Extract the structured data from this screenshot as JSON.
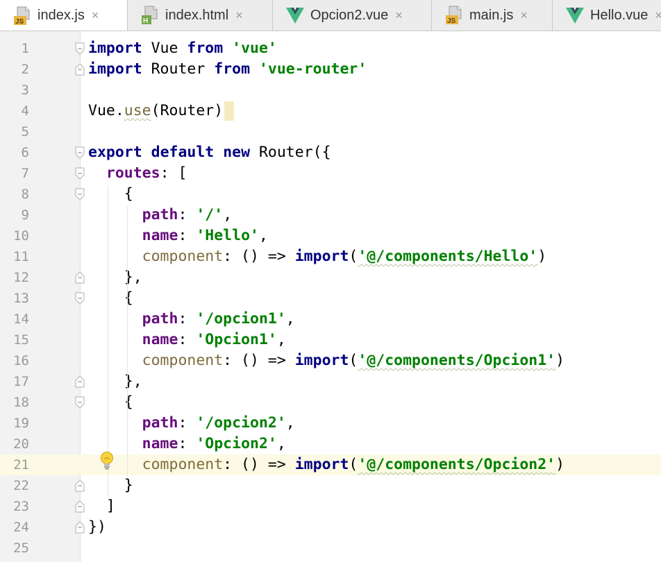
{
  "tabs": [
    {
      "label": "index.js",
      "icon": "js-file-icon",
      "active": true
    },
    {
      "label": "index.html",
      "icon": "html-file-icon",
      "active": false
    },
    {
      "label": "Opcion2.vue",
      "icon": "vue-file-icon",
      "active": false
    },
    {
      "label": "main.js",
      "icon": "js-file-icon",
      "active": false
    },
    {
      "label": "Hello.vue",
      "icon": "vue-file-icon",
      "active": false
    }
  ],
  "tab_close_symbol": "×",
  "colors": {
    "keyword": "#000080",
    "string": "#008000",
    "property": "#660e7a",
    "component_key": "#7d6b3a",
    "line_number": "#999999",
    "current_line": "#fcfae4",
    "vue_green": "#41b883",
    "vue_dark": "#35495e"
  },
  "current_line": 21,
  "lines": [
    {
      "n": "1",
      "t": [
        [
          "kw",
          "import"
        ],
        [
          "p",
          " Vue "
        ],
        [
          "kw",
          "from"
        ],
        [
          "p",
          " "
        ],
        [
          "str",
          "'vue'"
        ]
      ]
    },
    {
      "n": "2",
      "t": [
        [
          "kw",
          "import"
        ],
        [
          "p",
          " Router "
        ],
        [
          "kw",
          "from"
        ],
        [
          "p",
          " "
        ],
        [
          "str",
          "'vue-router'"
        ]
      ]
    },
    {
      "n": "3",
      "t": []
    },
    {
      "n": "4",
      "t": [
        [
          "p",
          "Vue."
        ],
        [
          "fnw",
          "use"
        ],
        [
          "p",
          "(Router)"
        ],
        [
          "caret",
          ""
        ]
      ]
    },
    {
      "n": "5",
      "t": []
    },
    {
      "n": "6",
      "t": [
        [
          "kw",
          "export"
        ],
        [
          "p",
          " "
        ],
        [
          "kw",
          "default"
        ],
        [
          "p",
          " "
        ],
        [
          "kw",
          "new"
        ],
        [
          "p",
          " Router({"
        ]
      ]
    },
    {
      "n": "7",
      "t": [
        [
          "p",
          "  "
        ],
        [
          "prop",
          "routes"
        ],
        [
          "p",
          ": ["
        ]
      ]
    },
    {
      "n": "8",
      "t": [
        [
          "p",
          "    {"
        ]
      ]
    },
    {
      "n": "9",
      "t": [
        [
          "p",
          "      "
        ],
        [
          "prop",
          "path"
        ],
        [
          "p",
          ": "
        ],
        [
          "str",
          "'/'"
        ],
        [
          "p",
          ","
        ]
      ]
    },
    {
      "n": "10",
      "t": [
        [
          "p",
          "      "
        ],
        [
          "prop",
          "name"
        ],
        [
          "p",
          ": "
        ],
        [
          "str",
          "'Hello'"
        ],
        [
          "p",
          ","
        ]
      ]
    },
    {
      "n": "11",
      "t": [
        [
          "p",
          "      "
        ],
        [
          "comp",
          "component"
        ],
        [
          "p",
          ": () => "
        ],
        [
          "kw",
          "import"
        ],
        [
          "p",
          "("
        ],
        [
          "strw",
          "'@/components/Hello'"
        ],
        [
          "p",
          ")"
        ]
      ]
    },
    {
      "n": "12",
      "t": [
        [
          "p",
          "    },"
        ]
      ]
    },
    {
      "n": "13",
      "t": [
        [
          "p",
          "    {"
        ]
      ]
    },
    {
      "n": "14",
      "t": [
        [
          "p",
          "      "
        ],
        [
          "prop",
          "path"
        ],
        [
          "p",
          ": "
        ],
        [
          "str",
          "'/opcion1'"
        ],
        [
          "p",
          ","
        ]
      ]
    },
    {
      "n": "15",
      "t": [
        [
          "p",
          "      "
        ],
        [
          "prop",
          "name"
        ],
        [
          "p",
          ": "
        ],
        [
          "str",
          "'Opcion1'"
        ],
        [
          "p",
          ","
        ]
      ]
    },
    {
      "n": "16",
      "t": [
        [
          "p",
          "      "
        ],
        [
          "comp",
          "component"
        ],
        [
          "p",
          ": () => "
        ],
        [
          "kw",
          "import"
        ],
        [
          "p",
          "("
        ],
        [
          "strw",
          "'@/components/Opcion1'"
        ],
        [
          "p",
          ")"
        ]
      ]
    },
    {
      "n": "17",
      "t": [
        [
          "p",
          "    },"
        ]
      ]
    },
    {
      "n": "18",
      "t": [
        [
          "p",
          "    {"
        ]
      ]
    },
    {
      "n": "19",
      "t": [
        [
          "p",
          "      "
        ],
        [
          "prop",
          "path"
        ],
        [
          "p",
          ": "
        ],
        [
          "str",
          "'/opcion2'"
        ],
        [
          "p",
          ","
        ]
      ]
    },
    {
      "n": "20",
      "t": [
        [
          "p",
          "      "
        ],
        [
          "prop",
          "name"
        ],
        [
          "p",
          ": "
        ],
        [
          "str",
          "'Opcion2'"
        ],
        [
          "p",
          ","
        ]
      ]
    },
    {
      "n": "21",
      "t": [
        [
          "p",
          "      "
        ],
        [
          "comp",
          "component"
        ],
        [
          "p",
          ": () => "
        ],
        [
          "kw",
          "import"
        ],
        [
          "p",
          "("
        ],
        [
          "strw",
          "'@/components/Opcion2'"
        ],
        [
          "p",
          ")"
        ]
      ]
    },
    {
      "n": "22",
      "t": [
        [
          "p",
          "    }"
        ]
      ]
    },
    {
      "n": "23",
      "t": [
        [
          "p",
          "  ]"
        ]
      ]
    },
    {
      "n": "24",
      "t": [
        [
          "p",
          "})"
        ]
      ]
    },
    {
      "n": "25",
      "t": []
    }
  ],
  "fold_markers": [
    {
      "line": 1,
      "kind": "start"
    },
    {
      "line": 2,
      "kind": "end"
    },
    {
      "line": 6,
      "kind": "start"
    },
    {
      "line": 7,
      "kind": "start"
    },
    {
      "line": 8,
      "kind": "start"
    },
    {
      "line": 12,
      "kind": "end"
    },
    {
      "line": 13,
      "kind": "start"
    },
    {
      "line": 17,
      "kind": "end"
    },
    {
      "line": 18,
      "kind": "start"
    },
    {
      "line": 22,
      "kind": "end"
    },
    {
      "line": 23,
      "kind": "end"
    },
    {
      "line": 24,
      "kind": "end"
    }
  ],
  "intention_bulb_line": 21
}
